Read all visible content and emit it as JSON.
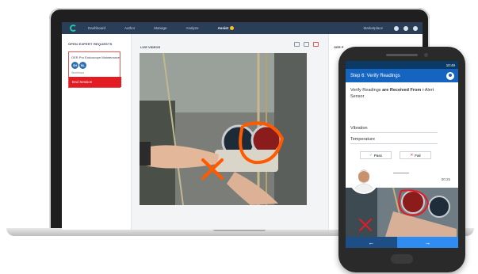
{
  "laptop": {
    "nav": {
      "items": [
        "Dashboard",
        "Author",
        "Manage",
        "Analyze",
        "Assist"
      ],
      "active": "Assist",
      "marketplace": "Marketplace"
    },
    "left_panel": {
      "title": "OPEN EXPERT REQUESTS",
      "request_name": "OER Pro Endoscope Maintenance",
      "avatars": [
        "SH",
        "BL"
      ],
      "request_sub": "Workflows",
      "end_session": "End Session"
    },
    "center_panel": {
      "live_label": "LIVE VIDEOS"
    },
    "right_panel": {
      "title": "OER P"
    }
  },
  "phone": {
    "status_time": "10:49",
    "step_title": "Step 6: Verify Readings",
    "verify_text_pre": "Verify Readings ",
    "verify_text_bold": "are Received From",
    "verify_text_post": " i-Alert Sensor",
    "readings": [
      "Vibration",
      "Temperature"
    ],
    "pass_label": "Pass",
    "fail_label": "Fail",
    "timer": "00:25",
    "back_arrow": "←",
    "next_arrow": "→"
  },
  "colors": {
    "nav_bg": "#2b3e58",
    "brand_teal": "#21c7a8",
    "end_red": "#e31b23",
    "step_blue": "#1565c0",
    "next_blue": "#2f8df1",
    "annotation_orange": "#ff5a00"
  }
}
